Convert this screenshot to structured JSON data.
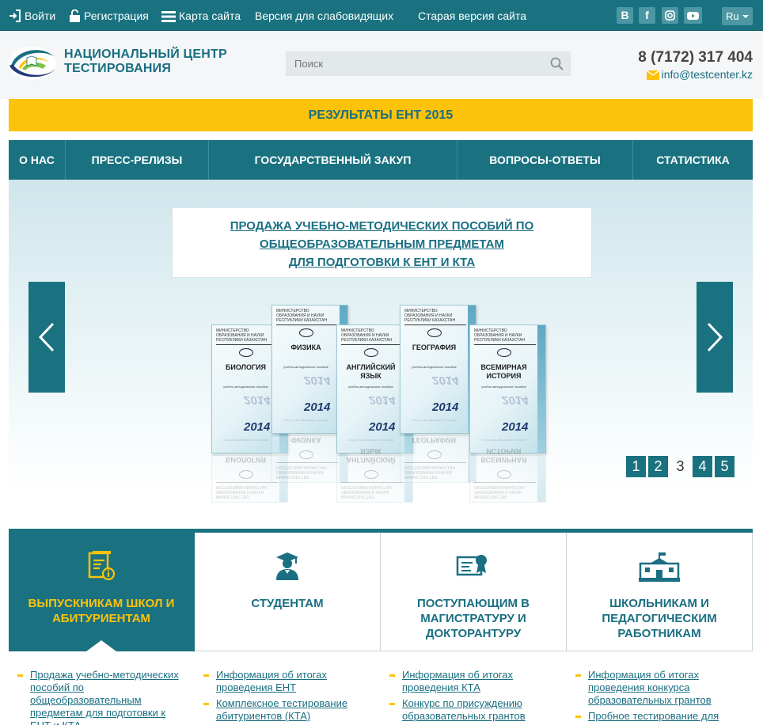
{
  "topbar": {
    "login": "Войти",
    "register": "Регистрация",
    "sitemap": "Карта сайта",
    "impaired": "Версия для слабовидящих",
    "old_version": "Старая версия сайта",
    "social": [
      "vk-icon",
      "facebook-icon",
      "instagram-icon",
      "youtube-icon"
    ],
    "language": "Ru"
  },
  "header": {
    "brand_line1": "НАЦИОНАЛЬНЫЙ ЦЕНТР",
    "brand_line2": "ТЕСТИРОВАНИЯ",
    "search_placeholder": "Поиск",
    "phone": "8 (7172) 317 404",
    "email": "info@testcenter.kz"
  },
  "banner": "РЕЗУЛЬТАТЫ ЕНТ 2015",
  "nav": [
    "О НАС",
    "ПРЕСС-РЕЛИЗЫ",
    "ГОСУДАРСТВЕННЫЙ ЗАКУП",
    "ВОПРОСЫ-ОТВЕТЫ",
    "СТАТИСТИКА"
  ],
  "slider": {
    "caption": [
      "ПРОДАЖА УЧЕБНО-МЕТОДИЧЕСКИХ ПОСОБИЙ ПО",
      "ОБЩЕОБРАЗОВАТЕЛЬНЫМ ПРЕДМЕТАМ",
      "ДЛЯ ПОДГОТОВКИ К ЕНТ И КТА"
    ],
    "book_header": "Министерство образования и науки Республики Казахстан",
    "book_sub": "учебно-методическое пособие",
    "book_year": "2014",
    "books": [
      "БИОЛОГИЯ",
      "ФИЗИКА",
      "АНГЛИЙСКИЙ ЯЗЫК",
      "ГЕОГРАФИЯ",
      "ВСЕМИРНАЯ ИСТОРИЯ"
    ],
    "pages": [
      "1",
      "2",
      "3",
      "4",
      "5"
    ],
    "active_page": "3"
  },
  "categories": [
    "ВЫПУСКНИКАМ ШКОЛ И АБИТУРИЕНТАМ",
    "СТУДЕНТАМ",
    "ПОСТУПАЮЩИМ В МАГИСТРАТУРУ И ДОКТОРАНТУРУ",
    "ШКОЛЬНИКАМ И ПЕДАГОГИЧЕСКИМ РАБОТНИКАМ"
  ],
  "links": {
    "col1": [
      "Продажа учебно-методических пособий по общеобразовательным предметам для подготовки к ЕНТ и КТА"
    ],
    "col2": [
      "Информация об итогах проведения ЕНТ",
      "Комплексное тестирование абитуриентов (КТА)"
    ],
    "col3": [
      "Информация об итогах проведения КТА",
      "Конкурс по присуждению образовательных грантов"
    ],
    "col4": [
      "Информация об итогах проведения конкурса образовательных грантов",
      "Пробное тестирование для"
    ]
  },
  "colors": {
    "teal": "#1a7280",
    "yellow": "#fdc20a",
    "link": "#1a6f82"
  }
}
